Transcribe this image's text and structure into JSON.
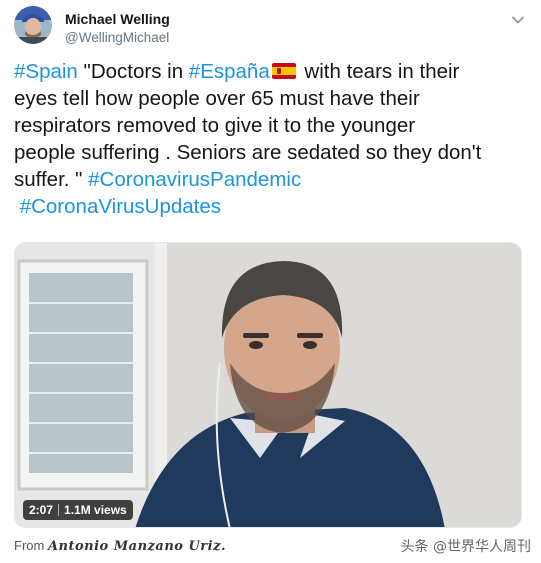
{
  "tweet": {
    "author": {
      "name": "Michael Welling",
      "handle": "@WellingMichael",
      "avatar_icon": "avatar-photo"
    },
    "menu_icon": "chevron-down-icon",
    "text": {
      "line1": {
        "tag1": "#Spain",
        "t1": " \"Doctors in ",
        "tag2": "#España",
        "flag_icon": "spain-flag-icon",
        "t2": " with tears in their"
      },
      "line2": "eyes tell how people over 65 must have their",
      "line3": "respirators removed to give it to the younger",
      "line4": "people suffering . Seniors are sedated so they don't",
      "line5": {
        "t1": "suffer. \" ",
        "tag": "#CoronavirusPandemic"
      },
      "line6": {
        "tag": "#CoronaVirusUpdates"
      }
    },
    "hashtag_color": "#1b95e0",
    "media": {
      "type": "video",
      "duration": "2:07",
      "views": "1.1M views"
    }
  },
  "credit": {
    "prefix": "From ",
    "name": "Antonio Manzano Uriz."
  },
  "watermark": "头条 @世界华人周刊"
}
